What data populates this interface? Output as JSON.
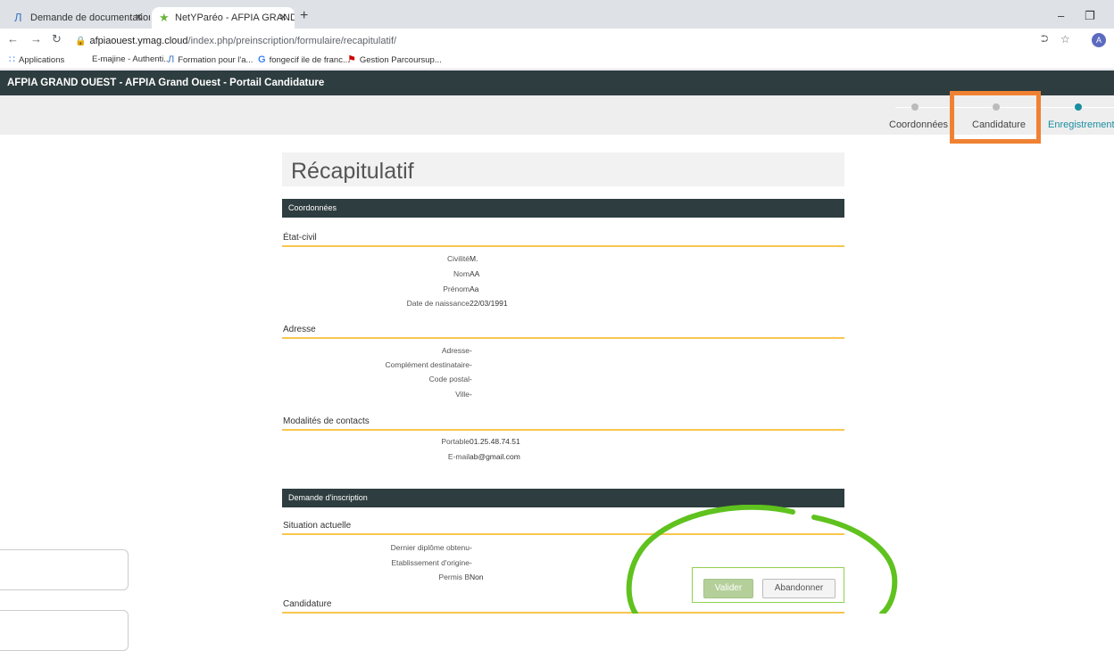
{
  "browser": {
    "tabs": [
      {
        "title": "Demande de documentation sur",
        "icon": "afpia-icon"
      },
      {
        "title": "NetYParéo - AFPIA GRAND OUES",
        "icon": "netypareo-icon"
      }
    ],
    "url_host": "afpiaouest.ymag.cloud",
    "url_path": "/index.php/preinscription/formulaire/recapitulatif/",
    "avatar_letter": "A",
    "bookmarks": [
      {
        "label": "Applications"
      },
      {
        "label": "E-majine - Authenti..."
      },
      {
        "label": "Formation pour l'a..."
      },
      {
        "label": "fongecif ile de franc..."
      },
      {
        "label": "Gestion Parcoursup..."
      }
    ]
  },
  "app": {
    "header_title": "AFPIA GRAND OUEST - AFPIA Grand Ouest - Portail Candidature",
    "steps": [
      {
        "label": "Coordonnées",
        "active": false
      },
      {
        "label": "Candidature",
        "active": false
      },
      {
        "label": "Enregistrement",
        "active": true
      }
    ]
  },
  "page": {
    "title": "Récapitulatif",
    "sections": [
      {
        "title": "Coordonnées"
      },
      {
        "title": "Demande d'inscription"
      }
    ],
    "etat_civil": {
      "heading": "État-civil",
      "rows": [
        {
          "label": "Civilité",
          "value": "M."
        },
        {
          "label": "Nom",
          "value": "AA"
        },
        {
          "label": "Prénom",
          "value": "Aa"
        },
        {
          "label": "Date de naissance",
          "value": "22/03/1991"
        }
      ]
    },
    "adresse": {
      "heading": "Adresse",
      "rows": [
        {
          "label": "Adresse",
          "value": "-"
        },
        {
          "label": "Complément destinataire",
          "value": "-"
        },
        {
          "label": "Code postal",
          "value": "-"
        },
        {
          "label": "Ville",
          "value": "-"
        }
      ]
    },
    "contacts": {
      "heading": "Modalités de contacts",
      "rows": [
        {
          "label": "Portable",
          "value": "01.25.48.74.51"
        },
        {
          "label": "E-mail",
          "value": "ab@gmail.com"
        }
      ]
    },
    "situation": {
      "heading": "Situation actuelle",
      "rows": [
        {
          "label": "Dernier diplôme obtenu",
          "value": "-"
        },
        {
          "label": "Etablissement d'origine",
          "value": "-"
        },
        {
          "label": "Permis B",
          "value": "Non"
        }
      ]
    },
    "candidature_heading": "Candidature",
    "actions": {
      "validate": "Valider",
      "cancel": "Abandonner"
    }
  },
  "colors": {
    "header_bg": "#2e3d3f",
    "underline": "#f7c64f",
    "accent": "#1a8fa0",
    "highlight_box": "#f08133",
    "annotation_circle": "#5fc21e"
  }
}
